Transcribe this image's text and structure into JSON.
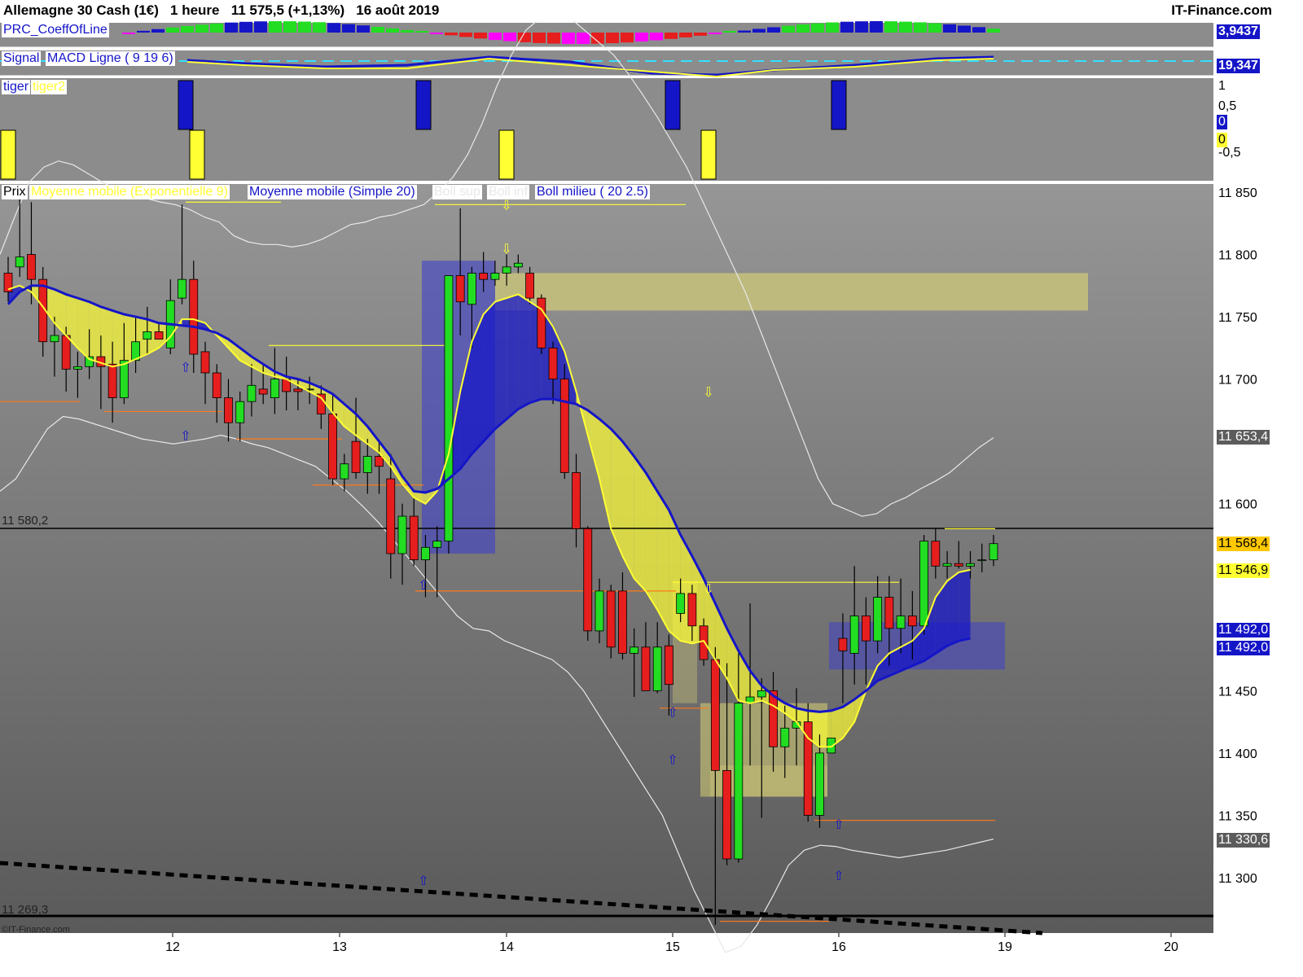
{
  "header": {
    "instrument": "Allemagne 30 Cash (1€)",
    "timeframe": "1 heure",
    "last": "11 575,5 (+1,13%)",
    "date": "16 août 2019",
    "brand": "IT-Finance.com"
  },
  "copyright": "©IT-Finance.com",
  "colors": {
    "background_top": "#949494",
    "background_bottom": "#5c5c5c",
    "bull": "#22dd22",
    "bear": "#e61e1e",
    "ema": "#ffff33",
    "sma": "#1515c8",
    "bollinger": "#e8e8e8",
    "support": "#ff7a1a",
    "price_tag": "#ffc800"
  },
  "panels": {
    "coeff": {
      "label": "PRC_CoeffOfLine",
      "value": "3,9437"
    },
    "macd": {
      "label_signal": "Signal",
      "label_line": "MACD Ligne ( 9 19 6)",
      "value": "19,347"
    },
    "tiger": {
      "label_1": "tiger",
      "label_2": "tiger2",
      "ticks": [
        "1",
        "0,5",
        "-0,5"
      ],
      "value_blue": "0",
      "value_yellow": "0"
    }
  },
  "legend": {
    "price": "Prix",
    "ema": "Moyenne mobile (Exponentielle 9)",
    "sma": "Moyenne mobile (Simple 20)",
    "boll_sup": "Boll sup",
    "boll_inf": "Boll inf",
    "boll_mid": "Boll milieu ( 20 2.5)"
  },
  "level_labels": {
    "resistance": "11 580,2",
    "support": "11 269,3"
  },
  "price_tags": {
    "boll_up": "11 653,4",
    "last": "11 568,4",
    "ema": "11 546,9",
    "sma_1": "11 492,0",
    "sma_2": "11 492,0",
    "boll_low": "11 330,6"
  },
  "chart_data": {
    "type": "candlestick",
    "title": "Allemagne 30 Cash (1€)",
    "timeframe": "1 heure",
    "x_ticks": [
      "12",
      "13",
      "14",
      "15",
      "16",
      "19",
      "20"
    ],
    "y_ticks": [
      11850,
      11800,
      11750,
      11700,
      11600,
      11450,
      11400,
      11350,
      11300
    ],
    "ylim": [
      11240,
      11862
    ],
    "horizontal_levels": [
      11580.2,
      11269.3
    ],
    "candles_ohlc": [
      [
        11785,
        11798,
        11762,
        11770
      ],
      [
        11790,
        11845,
        11782,
        11798
      ],
      [
        11800,
        11842,
        11760,
        11780
      ],
      [
        11780,
        11790,
        11718,
        11730
      ],
      [
        11730,
        11750,
        11702,
        11735
      ],
      [
        11735,
        11742,
        11690,
        11708
      ],
      [
        11708,
        11722,
        11685,
        11710
      ],
      [
        11710,
        11740,
        11700,
        11718
      ],
      [
        11718,
        11735,
        11676,
        11710
      ],
      [
        11712,
        11730,
        11665,
        11685
      ],
      [
        11685,
        11745,
        11680,
        11715
      ],
      [
        11715,
        11750,
        11705,
        11730
      ],
      [
        11732,
        11758,
        11720,
        11738
      ],
      [
        11738,
        11745,
        11732,
        11732
      ],
      [
        11725,
        11780,
        11720,
        11763
      ],
      [
        11765,
        11840,
        11760,
        11780
      ],
      [
        11780,
        11795,
        11705,
        11720
      ],
      [
        11722,
        11730,
        11680,
        11705
      ],
      [
        11705,
        11712,
        11665,
        11685
      ],
      [
        11685,
        11700,
        11650,
        11665
      ],
      [
        11665,
        11690,
        11650,
        11682
      ],
      [
        11682,
        11712,
        11670,
        11695
      ],
      [
        11692,
        11712,
        11680,
        11688
      ],
      [
        11685,
        11725,
        11672,
        11700
      ],
      [
        11700,
        11718,
        11675,
        11690
      ],
      [
        11692,
        11700,
        11675,
        11690
      ],
      [
        11692,
        11702,
        11680,
        11692
      ],
      [
        11688,
        11695,
        11660,
        11672
      ],
      [
        11672,
        11688,
        11615,
        11620
      ],
      [
        11620,
        11640,
        11610,
        11632
      ],
      [
        11650,
        11685,
        11620,
        11625
      ],
      [
        11625,
        11652,
        11608,
        11638
      ],
      [
        11638,
        11650,
        11608,
        11630
      ],
      [
        11620,
        11640,
        11540,
        11560
      ],
      [
        11560,
        11600,
        11535,
        11590
      ],
      [
        11590,
        11605,
        11550,
        11555
      ],
      [
        11555,
        11575,
        11525,
        11565
      ],
      [
        11565,
        11582,
        11525,
        11570
      ],
      [
        11570,
        11730,
        11560,
        11783
      ],
      [
        11783,
        11837,
        11735,
        11762
      ],
      [
        11760,
        11790,
        11725,
        11785
      ],
      [
        11785,
        11802,
        11770,
        11780
      ],
      [
        11780,
        11795,
        11775,
        11785
      ],
      [
        11785,
        11800,
        11775,
        11790
      ],
      [
        11790,
        11800,
        11785,
        11793
      ],
      [
        11785,
        11790,
        11760,
        11765
      ],
      [
        11765,
        11768,
        11720,
        11725
      ],
      [
        11725,
        11730,
        11680,
        11700
      ],
      [
        11700,
        11712,
        11620,
        11625
      ],
      [
        11625,
        11640,
        11565,
        11580
      ],
      [
        11580,
        11582,
        11490,
        11498
      ],
      [
        11498,
        11540,
        11488,
        11530
      ],
      [
        11530,
        11535,
        11476,
        11485
      ],
      [
        11530,
        11545,
        11475,
        11480
      ],
      [
        11480,
        11500,
        11445,
        11485
      ],
      [
        11485,
        11505,
        11455,
        11450
      ],
      [
        11450,
        11505,
        11448,
        11485
      ],
      [
        11486,
        11495,
        11430,
        11455
      ],
      [
        11512,
        11540,
        11505,
        11528
      ],
      [
        11528,
        11535,
        11490,
        11502
      ],
      [
        11502,
        11508,
        11470,
        11475
      ],
      [
        11475,
        11485,
        11262,
        11386
      ],
      [
        11386,
        11472,
        11310,
        11315
      ],
      [
        11315,
        11480,
        11312,
        11440
      ],
      [
        11440,
        11520,
        11390,
        11445
      ],
      [
        11445,
        11460,
        11348,
        11450
      ],
      [
        11450,
        11465,
        11385,
        11405
      ],
      [
        11405,
        11438,
        11380,
        11420
      ],
      [
        11420,
        11452,
        11390,
        11425
      ],
      [
        11425,
        11440,
        11345,
        11350
      ],
      [
        11350,
        11415,
        11340,
        11400
      ],
      [
        11400,
        11412,
        11400,
        11412
      ],
      [
        11492,
        11512,
        11440,
        11482
      ],
      [
        11480,
        11550,
        11455,
        11510
      ],
      [
        11510,
        11525,
        11455,
        11490
      ],
      [
        11490,
        11542,
        11480,
        11525
      ],
      [
        11525,
        11542,
        11470,
        11500
      ],
      [
        11500,
        11540,
        11480,
        11510
      ],
      [
        11510,
        11530,
        11475,
        11502
      ],
      [
        11502,
        11575,
        11495,
        11570
      ],
      [
        11570,
        11580,
        11540,
        11550
      ],
      [
        11550,
        11562,
        11540,
        11552
      ],
      [
        11552,
        11570,
        11548,
        11550
      ],
      [
        11550,
        11562,
        11540,
        11552
      ],
      [
        11555,
        11568,
        11545,
        11555
      ],
      [
        11555,
        11575,
        11550,
        11568
      ]
    ],
    "ema_9": [
      11772,
      11775,
      11770,
      11758,
      11745,
      11735,
      11725,
      11716,
      11713,
      11710,
      11712,
      11716,
      11720,
      11725,
      11734,
      11748,
      11748,
      11745,
      11735,
      11725,
      11715,
      11710,
      11705,
      11702,
      11700,
      11695,
      11690,
      11685,
      11673,
      11662,
      11655,
      11648,
      11641,
      11630,
      11616,
      11605,
      11600,
      11610,
      11640,
      11690,
      11730,
      11752,
      11762,
      11765,
      11768,
      11762,
      11756,
      11742,
      11722,
      11690,
      11655,
      11620,
      11580,
      11558,
      11540,
      11530,
      11515,
      11498,
      11490,
      11488,
      11490,
      11475,
      11460,
      11442,
      11440,
      11442,
      11438,
      11432,
      11425,
      11412,
      11405,
      11405,
      11412,
      11425,
      11450,
      11470,
      11480,
      11485,
      11490,
      11500,
      11525,
      11538,
      11545,
      11547
    ],
    "sma_20": [
      11760,
      11770,
      11775,
      11775,
      11772,
      11768,
      11765,
      11762,
      11758,
      11755,
      11752,
      11750,
      11748,
      11745,
      11744,
      11743,
      11742,
      11740,
      11737,
      11732,
      11725,
      11718,
      11712,
      11706,
      11702,
      11700,
      11697,
      11693,
      11688,
      11680,
      11672,
      11662,
      11650,
      11638,
      11622,
      11610,
      11609,
      11612,
      11620,
      11628,
      11640,
      11650,
      11660,
      11668,
      11676,
      11681,
      11684,
      11684,
      11682,
      11680,
      11675,
      11668,
      11660,
      11650,
      11638,
      11625,
      11610,
      11595,
      11575,
      11558,
      11540,
      11520,
      11500,
      11482,
      11466,
      11454,
      11446,
      11440,
      11436,
      11434,
      11433,
      11434,
      11437,
      11443,
      11450,
      11458,
      11462,
      11466,
      11470,
      11474,
      11480,
      11486,
      11490,
      11492
    ],
    "boll_up": [
      11800,
      11830,
      11858,
      11870,
      11875,
      11872,
      11865,
      11858,
      11852,
      11848,
      11845,
      11842,
      11840,
      11836,
      11830,
      11826,
      11815,
      11810,
      11808,
      11808,
      11806,
      11808,
      11812,
      11818,
      11824,
      11826,
      11830,
      11832,
      11836,
      11840,
      11850,
      11862,
      11880,
      11905,
      11935,
      11960,
      11980,
      11990,
      11995,
      11990,
      11980,
      11970,
      11960,
      11945,
      11928,
      11910,
      11890,
      11870,
      11845,
      11820,
      11795,
      11770,
      11740,
      11710,
      11680,
      11650,
      11620,
      11600,
      11595,
      11590,
      11592,
      11600,
      11605,
      11612,
      11618,
      11625,
      11635,
      11645,
      11653
    ],
    "boll_low": [
      11610,
      11620,
      11640,
      11660,
      11670,
      11668,
      11664,
      11660,
      11656,
      11652,
      11650,
      11648,
      11650,
      11652,
      11655,
      11652,
      11648,
      11645,
      11640,
      11635,
      11630,
      11620,
      11610,
      11598,
      11585,
      11570,
      11555,
      11540,
      11525,
      11510,
      11500,
      11498,
      11490,
      11485,
      11480,
      11475,
      11465,
      11450,
      11430,
      11410,
      11390,
      11370,
      11350,
      11320,
      11290,
      11265,
      11240,
      11245,
      11262,
      11285,
      11310,
      11322,
      11326,
      11325,
      11322,
      11320,
      11318,
      11316,
      11318,
      11320,
      11322,
      11325,
      11328,
      11331
    ]
  }
}
